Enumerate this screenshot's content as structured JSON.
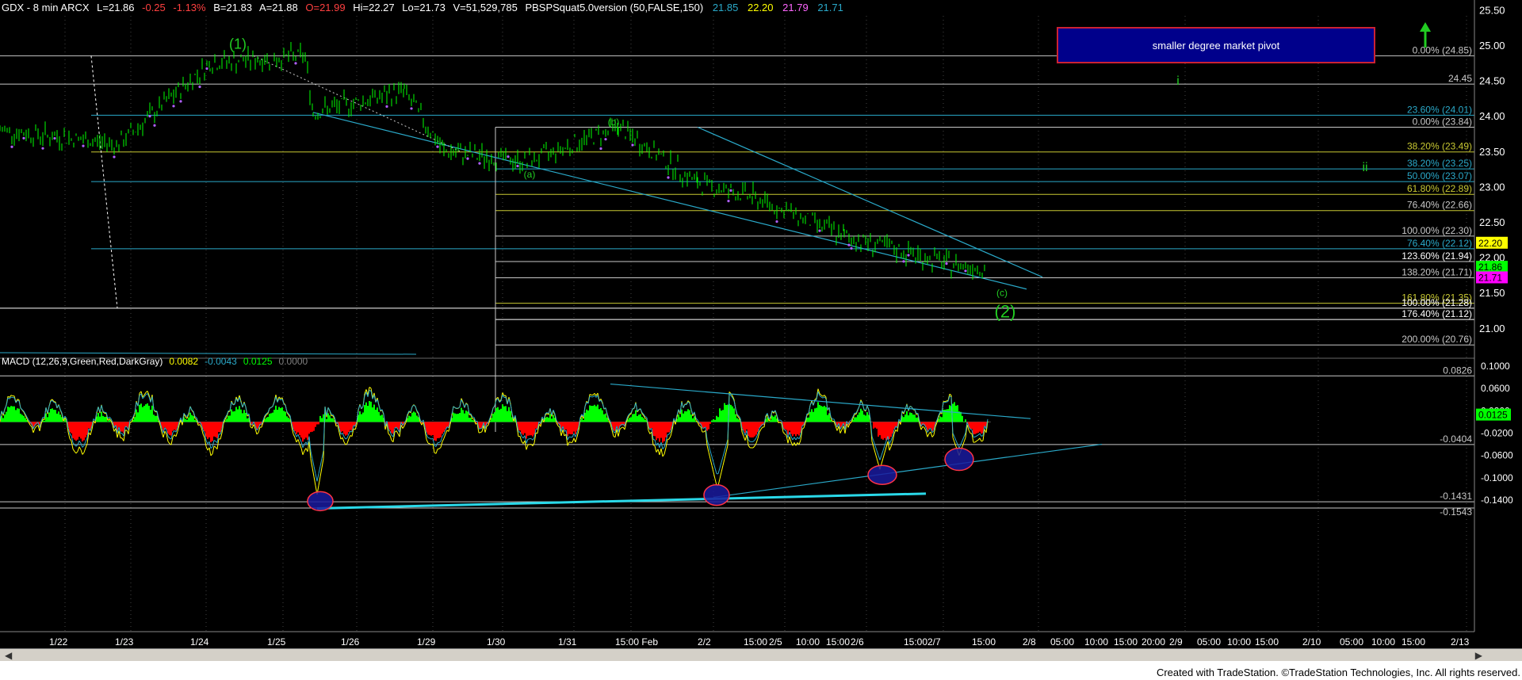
{
  "header": {
    "symbol": "GDX - 8 min  ARCX",
    "last": "L=21.86",
    "change": "-0.25",
    "pct": "-1.13%",
    "bid": "B=21.83",
    "ask": "A=21.88",
    "open": "O=21.99",
    "high": "Hi=22.27",
    "low": "Lo=21.73",
    "volume": "V=51,529,785",
    "indicator": "PBSPSquat5.0version (50,FALSE,150)",
    "ind_values": [
      "21.85",
      "22.20",
      "21.79",
      "21.71"
    ]
  },
  "pivot_box": {
    "label": "smaller degree market pivot"
  },
  "wave_labels": {
    "w1": "(1)",
    "w2": "(2)",
    "a": "(a)",
    "b": "(b)",
    "c": "(c)",
    "i": "i",
    "ii": "ii"
  },
  "price_axis": {
    "ticks": [
      "25.50",
      "25.00",
      "24.50",
      "24.00",
      "23.50",
      "23.00",
      "22.50",
      "22.00",
      "21.50",
      "21.00"
    ],
    "tags": [
      {
        "label": "22.20",
        "bg": "#ffff00",
        "fg": "#000000"
      },
      {
        "label": "21.86",
        "bg": "#00ff00",
        "fg": "#000000"
      },
      {
        "label": "21.71",
        "bg": "#ff00ff",
        "fg": "#000000"
      }
    ]
  },
  "fib_labels": [
    {
      "text": "0.00% (24.85)",
      "color": "#c8c8c8"
    },
    {
      "text": "24.45",
      "color": "#c8c8c8"
    },
    {
      "text": "23.60% (24.01)",
      "color": "#2aa9c9"
    },
    {
      "text": "0.00% (23.84)",
      "color": "#c8c8c8"
    },
    {
      "text": "38.20% (23.49)",
      "color": "#c8c832"
    },
    {
      "text": "38.20% (23.25)",
      "color": "#2aa9c9"
    },
    {
      "text": "50.00% (23.07)",
      "color": "#2aa9c9"
    },
    {
      "text": "61.80% (22.89)",
      "color": "#c8c832"
    },
    {
      "text": "76.40% (22.66)",
      "color": "#c8c8c8"
    },
    {
      "text": "100.00% (22.30)",
      "color": "#c8c8c8"
    },
    {
      "text": "76.40% (22.12)",
      "color": "#2aa9c9"
    },
    {
      "text": "123.60% (21.94)",
      "color": "#ffffff"
    },
    {
      "text": "138.20% (21.71)",
      "color": "#c8c8c8"
    },
    {
      "text": "161.80% (21.35)",
      "color": "#c8c832"
    },
    {
      "text": "100.00% (21.28)",
      "color": "#ffffff"
    },
    {
      "text": "176.40% (21.12)",
      "color": "#ffffff"
    },
    {
      "text": "200.00% (20.76)",
      "color": "#c8c8c8"
    }
  ],
  "macd": {
    "title": "MACD (12,26,9,Green,Red,DarkGray)",
    "values": [
      {
        "v": "0.0082",
        "color": "#ffff00"
      },
      {
        "v": "-0.0043",
        "color": "#2aa9c9"
      },
      {
        "v": "0.0125",
        "color": "#00ff00"
      },
      {
        "v": "0.0000",
        "color": "#808080"
      }
    ],
    "axis_ticks": [
      "0.1000",
      "0.0600",
      "0.0200",
      "-0.0200",
      "-0.0600",
      "-0.1000",
      "-0.1400"
    ],
    "levels": [
      "0.0826",
      "-0.0404",
      "-0.1431",
      "-0.1543"
    ],
    "tag": {
      "label": "0.0125",
      "bg": "#00ff00",
      "fg": "#000000"
    }
  },
  "time_axis": [
    "1/22",
    "1/23",
    "1/24",
    "1/25",
    "1/26",
    "1/29",
    "1/30",
    "1/31",
    "15:00 Feb",
    "2/2",
    "15:00",
    "2/5",
    "10:00",
    "15:00",
    "2/6",
    "15:00",
    "2/7",
    "15:00",
    "2/8",
    "05:00",
    "10:00",
    "15:00",
    "20:00",
    "2/9",
    "05:00",
    "10:00",
    "15:00",
    "2/10",
    "05:00",
    "10:00",
    "15:00",
    "2/13"
  ],
  "footer": "Created with TradeStation. ©TradeStation Technologies, Inc. All rights reserved.",
  "colors": {
    "price_bars": "#00ff00",
    "trend_lines": "#2aa9c9",
    "macd_hist_pos": "#00ff00",
    "macd_hist_neg": "#ff0000",
    "macd_line": "#ffff00",
    "signal_line": "#2aa9c9",
    "wave_labels": "#22cc22",
    "ellipse": "#1a1a9e"
  },
  "chart_data": {
    "type": "line",
    "series": [],
    "x": [
      "1/22",
      "1/23",
      "1/24",
      "1/25",
      "1/26",
      "1/29",
      "1/30",
      "1/31",
      "Feb",
      "2/2",
      "2/5",
      "2/6",
      "2/7",
      "2/8"
    ],
    "price_path": [
      23.8,
      23.6,
      24.75,
      24.85,
      24.05,
      24.35,
      23.5,
      23.35,
      23.84,
      23.05,
      22.85,
      22.3,
      21.9,
      21.86
    ],
    "fib_levels": [
      24.85,
      24.45,
      24.01,
      23.84,
      23.49,
      23.25,
      23.07,
      22.89,
      22.66,
      22.3,
      22.12,
      21.94,
      21.71,
      21.35,
      21.28,
      21.12,
      20.76
    ],
    "ylim": [
      20.65,
      25.55
    ],
    "macd_ylim": [
      -0.16,
      0.11
    ],
    "grid": true
  }
}
